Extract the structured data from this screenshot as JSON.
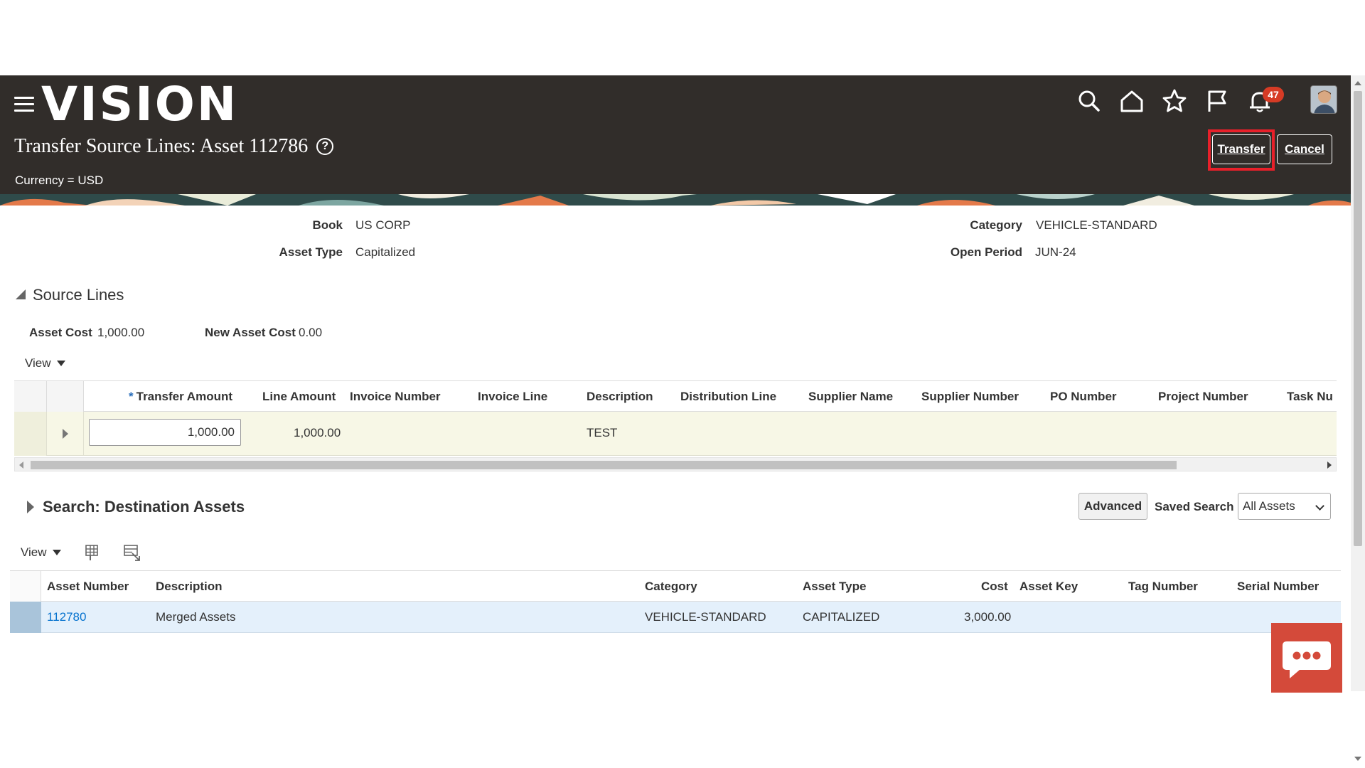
{
  "app": {
    "logo": "VISION"
  },
  "header": {
    "title": "Transfer Source Lines: Asset 112786",
    "currency": "Currency = USD",
    "notification_count": "47",
    "buttons": {
      "transfer": "Transfer",
      "cancel": "Cancel"
    },
    "icons": [
      "search-icon",
      "home-icon",
      "star-icon",
      "flag-icon",
      "bell-icon"
    ]
  },
  "details": {
    "book_label": "Book",
    "book_value": "US CORP",
    "asset_type_label": "Asset Type",
    "asset_type_value": "Capitalized",
    "category_label": "Category",
    "category_value": "VEHICLE-STANDARD",
    "open_period_label": "Open Period",
    "open_period_value": "JUN-24"
  },
  "source_lines": {
    "title": "Source Lines",
    "asset_cost_label": "Asset Cost",
    "asset_cost_value": "1,000.00",
    "new_asset_cost_label": "New Asset Cost",
    "new_asset_cost_value": "0.00",
    "view_label": "View",
    "columns": {
      "transfer_amount": "Transfer Amount",
      "line_amount": "Line Amount",
      "invoice_number": "Invoice Number",
      "invoice_line": "Invoice Line",
      "description": "Description",
      "distribution_line": "Distribution Line",
      "supplier_name": "Supplier Name",
      "supplier_number": "Supplier Number",
      "po_number": "PO Number",
      "project_number": "Project Number",
      "task_number": "Task Nu"
    },
    "row": {
      "transfer_amount": "1,000.00",
      "line_amount": "1,000.00",
      "description": "TEST"
    }
  },
  "search": {
    "title": "Search: Destination Assets",
    "advanced_label": "Advanced",
    "saved_search_label": "Saved Search",
    "saved_search_value": "All Assets",
    "view_label": "View",
    "columns": {
      "asset_number": "Asset Number",
      "description": "Description",
      "category": "Category",
      "asset_type": "Asset Type",
      "cost": "Cost",
      "asset_key": "Asset Key",
      "tag_number": "Tag Number",
      "serial_number": "Serial Number"
    },
    "row": {
      "asset_number": "112780",
      "description": "Merged Assets",
      "category": "VEHICLE-STANDARD",
      "asset_type": "CAPITALIZED",
      "cost": "3,000.00"
    }
  },
  "colors": {
    "header_bg": "#312d2a",
    "highlight": "#e8202a",
    "link": "#0572ce",
    "chat": "#d44a3a",
    "badge": "#d63b25"
  }
}
